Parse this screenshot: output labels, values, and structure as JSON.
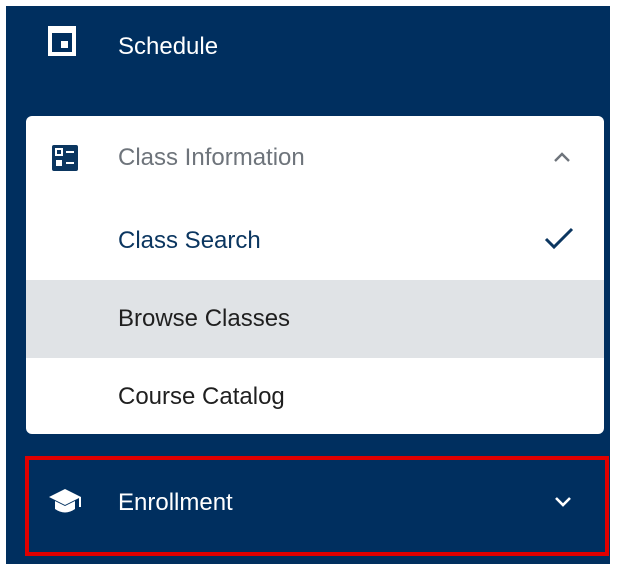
{
  "nav": {
    "schedule": {
      "label": "Schedule",
      "icon": "calendar-icon"
    },
    "class_information": {
      "label": "Class Information",
      "icon": "grid-list-icon",
      "expanded": true,
      "items": [
        {
          "label": "Class Search",
          "selected": true
        },
        {
          "label": "Browse Classes",
          "hovered": true
        },
        {
          "label": "Course Catalog"
        }
      ]
    },
    "enrollment": {
      "label": "Enrollment",
      "icon": "graduation-cap-icon",
      "expanded": false,
      "highlighted": true
    }
  },
  "colors": {
    "nav_background": "#002f5f",
    "card_background": "#ffffff",
    "hover_background": "#e0e3e6",
    "selected_text": "#0b3660",
    "highlight_border": "#e00000"
  }
}
